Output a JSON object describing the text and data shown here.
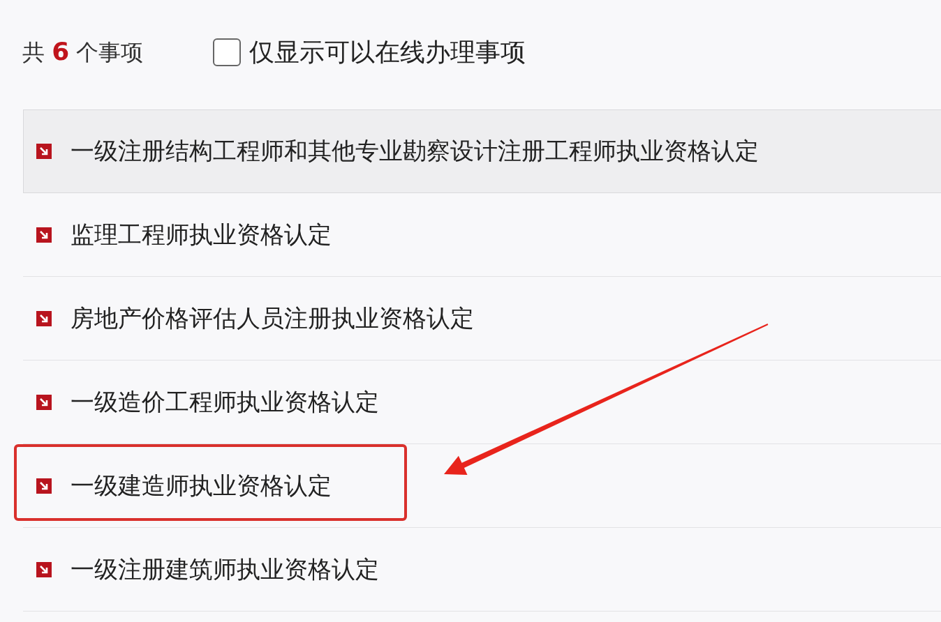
{
  "summary": {
    "count_text": "共 **6** 个事项"
  },
  "filter": {
    "label": "仅显示可以在线办理事项",
    "checked": false
  },
  "items": [
    {
      "title": "一级注册结构工程师和其他专业勘察设计注册工程师执业资格认定",
      "selected": true,
      "circled": false
    },
    {
      "title": "监理工程师执业资格认定",
      "selected": false,
      "circled": false
    },
    {
      "title": "房地产价格评估人员注册执业资格认定",
      "selected": false,
      "circled": false
    },
    {
      "title": "一级造价工程师执业资格认定",
      "selected": false,
      "circled": false
    },
    {
      "title": "一级建造师执业资格认定",
      "selected": false,
      "circled": true
    },
    {
      "title": "一级注册建筑师执业资格认定",
      "selected": false,
      "circled": false
    }
  ]
}
